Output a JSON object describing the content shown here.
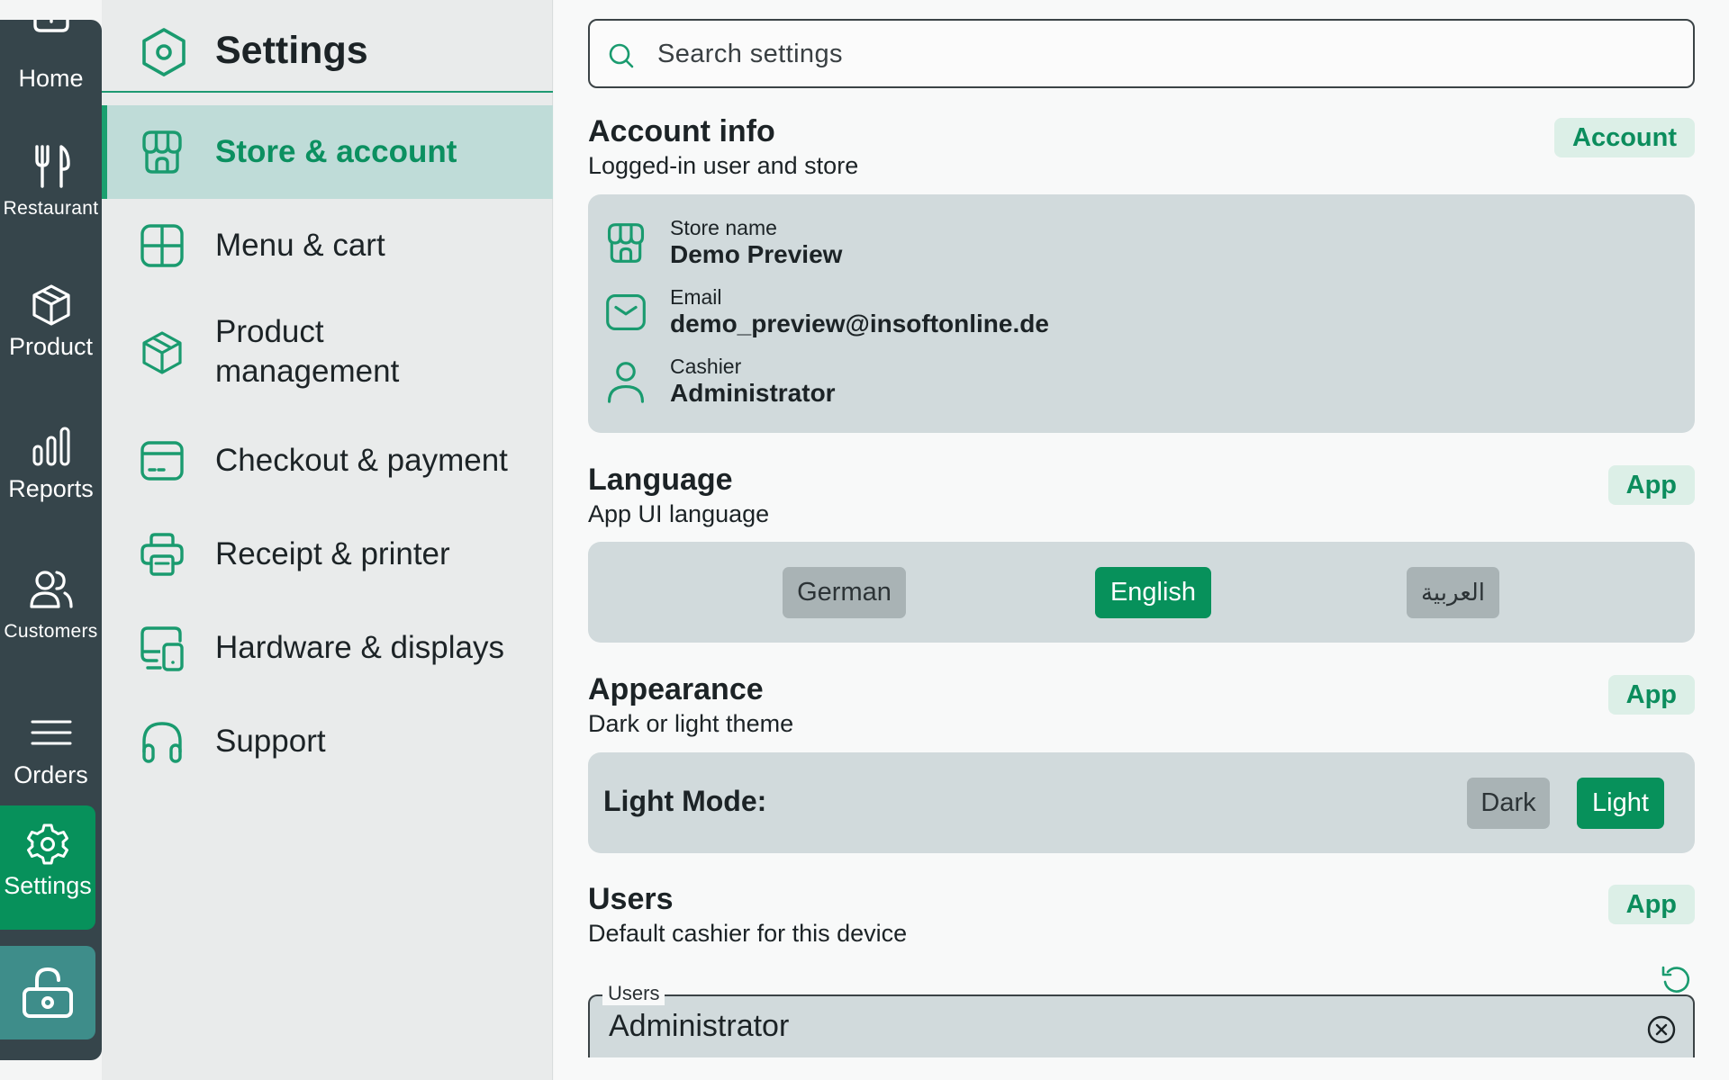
{
  "rail": {
    "items": [
      {
        "label": "Home"
      },
      {
        "label": "Restaurant"
      },
      {
        "label": "Product"
      },
      {
        "label": "Reports"
      },
      {
        "label": "Customers"
      },
      {
        "label": "Orders"
      },
      {
        "label": "Settings"
      }
    ]
  },
  "categories": {
    "title": "Settings",
    "items": [
      {
        "label": "Store & account",
        "icon": "store-icon",
        "active": true
      },
      {
        "label": "Menu & cart",
        "icon": "layout-grid-icon"
      },
      {
        "label": "Product management",
        "icon": "package-icon"
      },
      {
        "label": "Checkout & payment",
        "icon": "card-icon"
      },
      {
        "label": "Receipt & printer",
        "icon": "printer-icon"
      },
      {
        "label": "Hardware & displays",
        "icon": "devices-icon"
      },
      {
        "label": "Support",
        "icon": "headphones-icon"
      }
    ]
  },
  "search": {
    "placeholder": "Search settings"
  },
  "account": {
    "title": "Account info",
    "subtitle": "Logged-in user and store",
    "badge": "Account",
    "rows": [
      {
        "label": "Store name",
        "value": "Demo Preview",
        "icon": "store-icon"
      },
      {
        "label": "Email",
        "value": "demo_preview@insoftonline.de",
        "icon": "mail-icon"
      },
      {
        "label": "Cashier",
        "value": "Administrator",
        "icon": "user-icon"
      }
    ]
  },
  "language": {
    "title": "Language",
    "subtitle": "App UI language",
    "badge": "App",
    "options": [
      "German",
      "English",
      "العربية"
    ],
    "selected": "English"
  },
  "appearance": {
    "title": "Appearance",
    "subtitle": "Dark or light theme",
    "badge": "App",
    "mode_label": "Light Mode:",
    "dark_label": "Dark",
    "light_label": "Light",
    "selected": "Light"
  },
  "users": {
    "title": "Users",
    "subtitle": "Default cashier for this device",
    "badge": "App",
    "field_label": "Users",
    "field_value": "Administrator"
  },
  "colors": {
    "accent": "#07915b",
    "rail": "#36454b",
    "active_bg": "#bfdcd8",
    "card_bg": "#d1dadc"
  }
}
